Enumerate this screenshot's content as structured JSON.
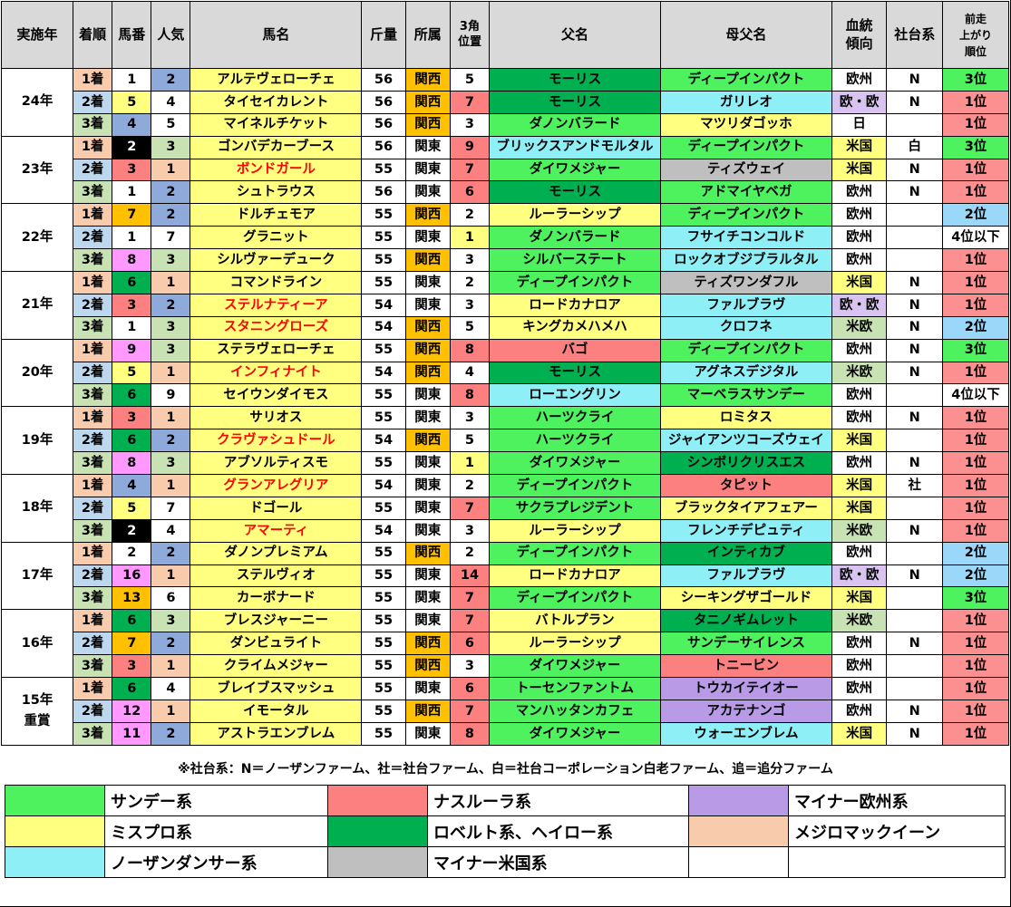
{
  "headers": {
    "year": "実施年",
    "order": "着順",
    "num": "馬番",
    "pop": "人気",
    "name": "馬名",
    "weight": "斤量",
    "belong": "所属",
    "pos3": "3角\n位置",
    "sire": "父名",
    "dam_sire": "母父名",
    "blood": "血統\n傾向",
    "farm": "社台系",
    "last": "前走\n上がり\n順位"
  },
  "groups": [
    {
      "year": "24年",
      "rows": [
        {
          "order": "1着",
          "num": "1",
          "pop": "2",
          "name": "アルテヴェローチェ",
          "weight": "56",
          "belong": "関西",
          "pos3": "5",
          "sire": "モーリス",
          "dam_sire": "ディープインパクト",
          "blood": "欧州",
          "farm": "N",
          "last": "3位"
        },
        {
          "order": "2着",
          "num": "5",
          "pop": "4",
          "name": "タイセイカレント",
          "weight": "56",
          "belong": "関西",
          "pos3": "7",
          "sire": "モーリス",
          "dam_sire": "ガリレオ",
          "blood": "欧・欧",
          "farm": "N",
          "last": "1位"
        },
        {
          "order": "3着",
          "num": "4",
          "pop": "5",
          "name": "マイネルチケット",
          "weight": "56",
          "belong": "関西",
          "pos3": "3",
          "sire": "ダノンバラード",
          "dam_sire": "マツリダゴッホ",
          "blood": "日",
          "farm": "",
          "last": "1位"
        }
      ]
    },
    {
      "year": "23年",
      "rows": [
        {
          "order": "1着",
          "num": "2",
          "pop": "3",
          "name": "ゴンバデカーブース",
          "weight": "56",
          "belong": "関東",
          "pos3": "9",
          "sire": "ブリックスアンドモルタル",
          "dam_sire": "ディープインパクト",
          "blood": "米国",
          "farm": "白",
          "last": "3位"
        },
        {
          "order": "2着",
          "num": "3",
          "pop": "1",
          "name": "ボンドガール",
          "weight": "55",
          "belong": "関東",
          "pos3": "7",
          "sire": "ダイワメジャー",
          "dam_sire": "ティズウェイ",
          "blood": "米国",
          "farm": "N",
          "last": "1位"
        },
        {
          "order": "3着",
          "num": "1",
          "pop": "2",
          "name": "シュトラウス",
          "weight": "56",
          "belong": "関東",
          "pos3": "6",
          "sire": "モーリス",
          "dam_sire": "アドマイヤベガ",
          "blood": "欧州",
          "farm": "N",
          "last": "1位"
        }
      ]
    },
    {
      "year": "22年",
      "rows": [
        {
          "order": "1着",
          "num": "7",
          "pop": "2",
          "name": "ドルチェモア",
          "weight": "55",
          "belong": "関西",
          "pos3": "2",
          "sire": "ルーラーシップ",
          "dam_sire": "ディープインパクト",
          "blood": "欧州",
          "farm": "",
          "last": "2位"
        },
        {
          "order": "2着",
          "num": "1",
          "pop": "7",
          "name": "グラニット",
          "weight": "55",
          "belong": "関東",
          "pos3": "1",
          "sire": "ダノンバラード",
          "dam_sire": "フサイチコンコルド",
          "blood": "欧州",
          "farm": "",
          "last": "4位以下"
        },
        {
          "order": "3着",
          "num": "8",
          "pop": "3",
          "name": "シルヴァーデューク",
          "weight": "55",
          "belong": "関西",
          "pos3": "3",
          "sire": "シルバーステート",
          "dam_sire": "ロックオブジブラルタル",
          "blood": "欧州",
          "farm": "",
          "last": "1位"
        }
      ]
    },
    {
      "year": "21年",
      "rows": [
        {
          "order": "1着",
          "num": "6",
          "pop": "1",
          "name": "コマンドライン",
          "weight": "55",
          "belong": "関東",
          "pos3": "2",
          "sire": "ディープインパクト",
          "dam_sire": "ティズワンダフル",
          "blood": "米国",
          "farm": "N",
          "last": "1位"
        },
        {
          "order": "2着",
          "num": "3",
          "pop": "2",
          "name": "ステルナティーア",
          "weight": "54",
          "belong": "関東",
          "pos3": "3",
          "sire": "ロードカナロア",
          "dam_sire": "ファルブラヴ",
          "blood": "欧・欧",
          "farm": "N",
          "last": "1位"
        },
        {
          "order": "3着",
          "num": "1",
          "pop": "3",
          "name": "スタニングローズ",
          "weight": "54",
          "belong": "関西",
          "pos3": "5",
          "sire": "キングカメハメハ",
          "dam_sire": "クロフネ",
          "blood": "米欧",
          "farm": "N",
          "last": "2位"
        }
      ]
    },
    {
      "year": "20年",
      "rows": [
        {
          "order": "1着",
          "num": "9",
          "pop": "3",
          "name": "ステラヴェローチェ",
          "weight": "55",
          "belong": "関西",
          "pos3": "8",
          "sire": "バゴ",
          "dam_sire": "ディープインパクト",
          "blood": "欧州",
          "farm": "N",
          "last": "3位"
        },
        {
          "order": "2着",
          "num": "5",
          "pop": "1",
          "name": "インフィナイト",
          "weight": "54",
          "belong": "関西",
          "pos3": "4",
          "sire": "モーリス",
          "dam_sire": "アグネスデジタル",
          "blood": "米欧",
          "farm": "N",
          "last": "1位"
        },
        {
          "order": "3着",
          "num": "6",
          "pop": "9",
          "name": "セイウンダイモス",
          "weight": "55",
          "belong": "関東",
          "pos3": "8",
          "sire": "ローエングリン",
          "dam_sire": "マーベラスサンデー",
          "blood": "欧州",
          "farm": "",
          "last": "4位以下"
        }
      ]
    },
    {
      "year": "19年",
      "rows": [
        {
          "order": "1着",
          "num": "3",
          "pop": "1",
          "name": "サリオス",
          "weight": "55",
          "belong": "関東",
          "pos3": "3",
          "sire": "ハーツクライ",
          "dam_sire": "ロミタス",
          "blood": "欧州",
          "farm": "N",
          "last": "1位"
        },
        {
          "order": "2着",
          "num": "6",
          "pop": "2",
          "name": "クラヴァシュドール",
          "weight": "54",
          "belong": "関西",
          "pos3": "5",
          "sire": "ハーツクライ",
          "dam_sire": "ジャイアンツコーズウェイ",
          "blood": "米国",
          "farm": "",
          "last": "1位"
        },
        {
          "order": "3着",
          "num": "8",
          "pop": "3",
          "name": "アブソルティスモ",
          "weight": "55",
          "belong": "関東",
          "pos3": "1",
          "sire": "ダイワメジャー",
          "dam_sire": "シンボリクリスエス",
          "blood": "欧州",
          "farm": "N",
          "last": "1位"
        }
      ]
    },
    {
      "year": "18年",
      "rows": [
        {
          "order": "1着",
          "num": "4",
          "pop": "1",
          "name": "グランアレグリア",
          "weight": "54",
          "belong": "関東",
          "pos3": "2",
          "sire": "ディープインパクト",
          "dam_sire": "タピット",
          "blood": "米国",
          "farm": "社",
          "last": "1位"
        },
        {
          "order": "2着",
          "num": "5",
          "pop": "7",
          "name": "ドゴール",
          "weight": "55",
          "belong": "関東",
          "pos3": "7",
          "sire": "サクラプレジデント",
          "dam_sire": "ブラックタイアフェアー",
          "blood": "米国",
          "farm": "",
          "last": "1位"
        },
        {
          "order": "3着",
          "num": "2",
          "pop": "4",
          "name": "アマーティ",
          "weight": "54",
          "belong": "関東",
          "pos3": "3",
          "sire": "ルーラーシップ",
          "dam_sire": "フレンチデピュティ",
          "blood": "米欧",
          "farm": "N",
          "last": "1位"
        }
      ]
    },
    {
      "year": "17年",
      "rows": [
        {
          "order": "1着",
          "num": "2",
          "pop": "2",
          "name": "ダノンプレミアム",
          "weight": "55",
          "belong": "関西",
          "pos3": "2",
          "sire": "ディープインパクト",
          "dam_sire": "インティカブ",
          "blood": "欧州",
          "farm": "",
          "last": "2位"
        },
        {
          "order": "2着",
          "num": "16",
          "pop": "1",
          "name": "ステルヴィオ",
          "weight": "55",
          "belong": "関東",
          "pos3": "14",
          "sire": "ロードカナロア",
          "dam_sire": "ファルブラヴ",
          "blood": "欧・欧",
          "farm": "N",
          "last": "2位"
        },
        {
          "order": "3着",
          "num": "13",
          "pop": "6",
          "name": "カーボナード",
          "weight": "55",
          "belong": "関東",
          "pos3": "7",
          "sire": "ディープインパクト",
          "dam_sire": "シーキングザゴールド",
          "blood": "米国",
          "farm": "",
          "last": "3位"
        }
      ]
    },
    {
      "year": "16年",
      "rows": [
        {
          "order": "1着",
          "num": "6",
          "pop": "3",
          "name": "ブレスジャーニー",
          "weight": "55",
          "belong": "関東",
          "pos3": "7",
          "sire": "バトルプラン",
          "dam_sire": "タニノギムレット",
          "blood": "米欧",
          "farm": "",
          "last": "1位"
        },
        {
          "order": "2着",
          "num": "7",
          "pop": "2",
          "name": "ダンビュライト",
          "weight": "55",
          "belong": "関西",
          "pos3": "6",
          "sire": "ルーラーシップ",
          "dam_sire": "サンデーサイレンス",
          "blood": "欧州",
          "farm": "N",
          "last": "1位"
        },
        {
          "order": "3着",
          "num": "3",
          "pop": "1",
          "name": "クライムメジャー",
          "weight": "55",
          "belong": "関西",
          "pos3": "3",
          "sire": "ダイワメジャー",
          "dam_sire": "トニービン",
          "blood": "欧州",
          "farm": "",
          "last": "1位"
        }
      ]
    },
    {
      "year": "15年\n重賞",
      "rows": [
        {
          "order": "1着",
          "num": "6",
          "pop": "4",
          "name": "ブレイブスマッシュ",
          "weight": "55",
          "belong": "関東",
          "pos3": "6",
          "sire": "トーセンファントム",
          "dam_sire": "トウカイテイオー",
          "blood": "欧州",
          "farm": "",
          "last": "1位"
        },
        {
          "order": "2着",
          "num": "12",
          "pop": "1",
          "name": "イモータル",
          "weight": "55",
          "belong": "関西",
          "pos3": "7",
          "sire": "マンハッタンカフェ",
          "dam_sire": "アカテナンゴ",
          "blood": "欧州",
          "farm": "N",
          "last": "1位"
        },
        {
          "order": "3着",
          "num": "11",
          "pop": "2",
          "name": "アストラエンブレム",
          "weight": "55",
          "belong": "関東",
          "pos3": "8",
          "sire": "ダイワメジャー",
          "dam_sire": "ウォーエンブレム",
          "blood": "米国",
          "farm": "N",
          "last": "1位"
        }
      ]
    }
  ],
  "note": "※社台系：N＝ノーザンファーム、社＝社台ファーム、白＝社台コーポレーション白老ファーム、追＝追分ファーム",
  "legend": [
    [
      "サンデー系",
      "ナスルーラ系",
      "マイナー欧州系"
    ],
    [
      "ミスプロ系",
      "ロベルト系、ヘイロー系",
      "メジロマックイーン"
    ],
    [
      "ノーザンダンサー系",
      "マイナー米国系",
      ""
    ]
  ],
  "colors": {
    "sunday": "#4ef25f",
    "mispro": "#ffff80",
    "northern_dancer": "#8ef0f6",
    "nasrullah": "#fc8080",
    "roberto_halo": "#00b050",
    "minor_us": "#bfbfbf",
    "minor_eu": "#b89ae6",
    "mejiro": "#f8cbad",
    "kansai": "#ffc000"
  }
}
